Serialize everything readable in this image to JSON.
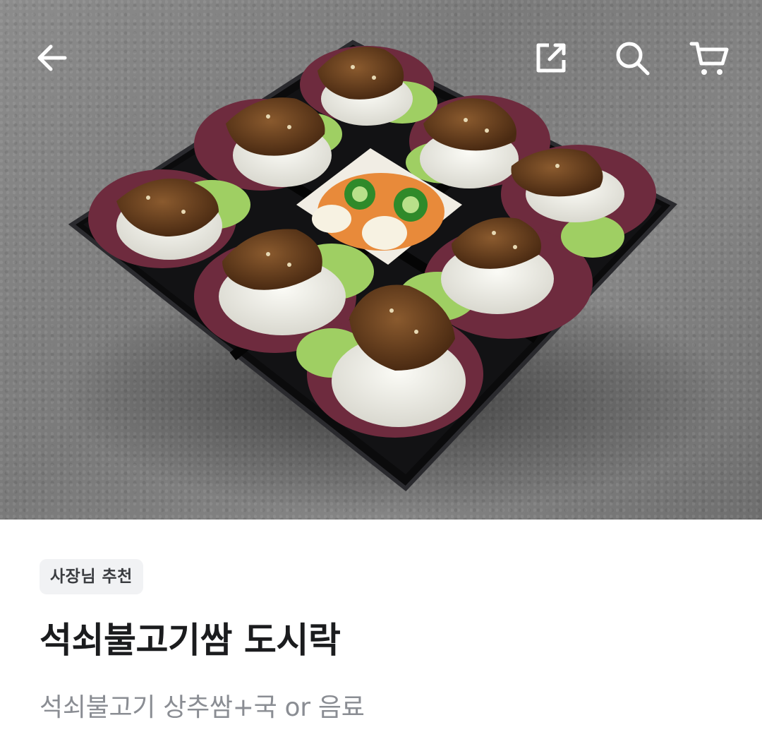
{
  "header": {
    "back_icon": "back-arrow-icon",
    "share_icon": "share-icon",
    "search_icon": "search-icon",
    "cart_icon": "cart-icon",
    "icon_color": "#ffffff"
  },
  "product": {
    "badge": "사장님 추천",
    "title": "석쇠불고기쌈 도시락",
    "description": "석쇠불고기 상추쌈+국 or 음료"
  }
}
